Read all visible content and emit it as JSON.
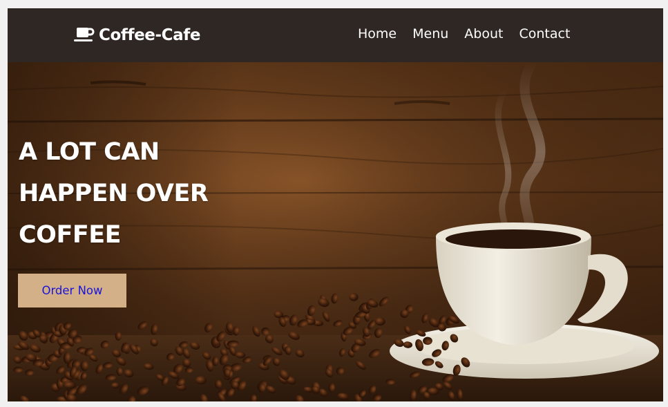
{
  "brand": {
    "icon": "coffee-cup-icon",
    "name": "Coffee-Cafe"
  },
  "nav": {
    "items": [
      {
        "label": "Home"
      },
      {
        "label": "Menu"
      },
      {
        "label": "About"
      },
      {
        "label": "Contact"
      }
    ]
  },
  "hero": {
    "headline_lines": [
      "A LOT CAN",
      "HAPPEN OVER",
      "COFFEE"
    ],
    "cta_label": "Order Now",
    "image": "coffee-cup-and-beans-photo"
  },
  "colors": {
    "navbar_bg": "#2e2724",
    "cta_bg": "#d4b088",
    "cta_text": "#1a13d8",
    "text": "#ffffff"
  }
}
